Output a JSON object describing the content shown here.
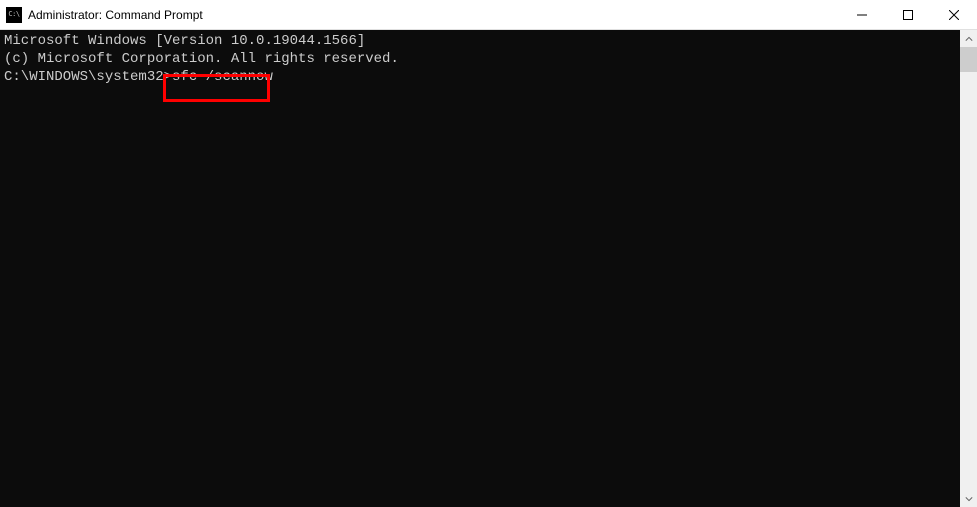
{
  "titlebar": {
    "title": "Administrator: Command Prompt"
  },
  "console": {
    "line1": "Microsoft Windows [Version 10.0.19044.1566]",
    "line2": "(c) Microsoft Corporation. All rights reserved.",
    "blank": "",
    "prompt": "C:\\WINDOWS\\system32>",
    "command": "sfc /scannow"
  }
}
